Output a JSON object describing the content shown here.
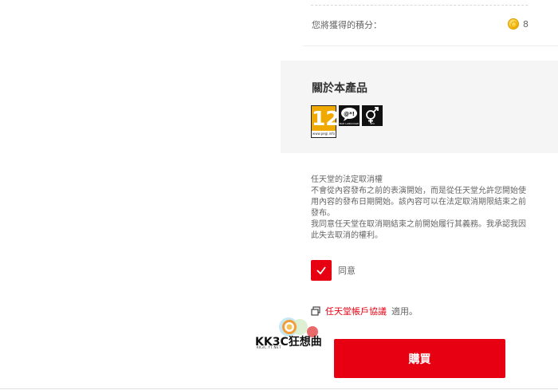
{
  "points": {
    "label": "您將獲得的積分：",
    "value": "8",
    "icon": "gold-coin-icon"
  },
  "about": {
    "title": "關於本產品",
    "ratings": {
      "pegi_age": "12",
      "pegi_url": "www.pegi.info",
      "descriptors": [
        {
          "icon": "bad-language-icon",
          "caption": "BAD LANGUAGE"
        },
        {
          "icon": "sex-icon",
          "caption": "SEX"
        }
      ]
    }
  },
  "legal": {
    "heading": "任天堂的法定取消權",
    "paragraph1": "不會從內容發布之前的表演開始，而是從任天堂允許您開始使用內容的發布日期開始。該內容可以在法定取消期限結束之前發布。",
    "paragraph2": "我同意任天堂在取消期結束之前開始履行其義務。我承認我因此失去取消的權利。"
  },
  "agree": {
    "label": "同意",
    "checked": true
  },
  "account": {
    "link_label": "任天堂帳戶協議",
    "suffix": "適用。"
  },
  "buy": {
    "label": "購買"
  },
  "watermark": {
    "text": "KK3C狂想曲",
    "subtext": "KK3C.YT.NET"
  },
  "colors": {
    "accent": "#e60012",
    "panel_bg": "#f5f5f5",
    "pegi_orange": "#f0a900"
  }
}
